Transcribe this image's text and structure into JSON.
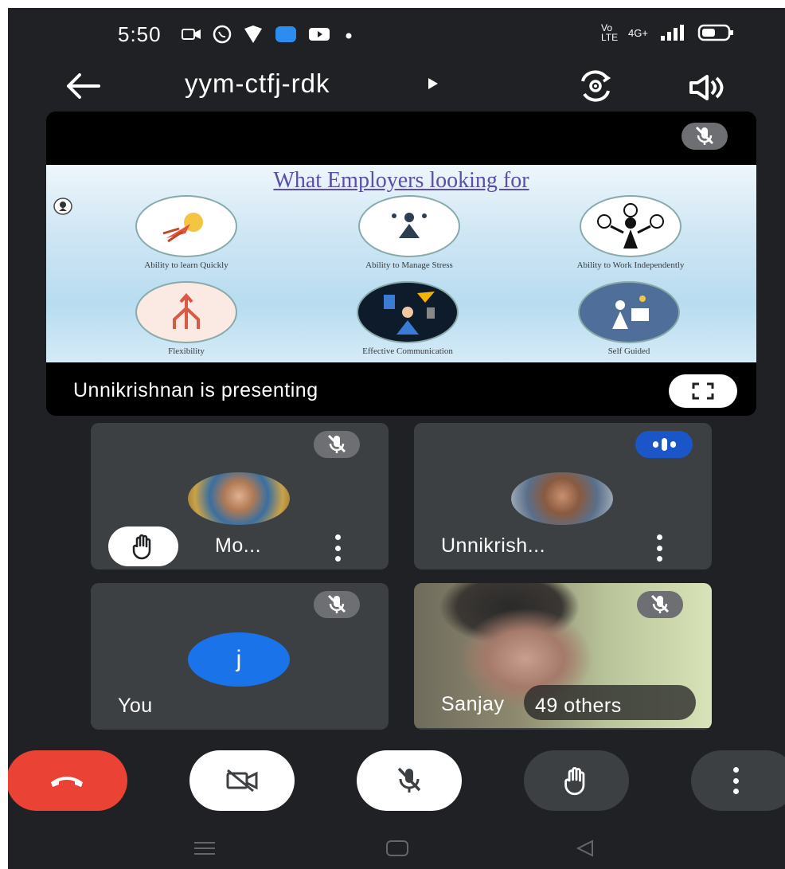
{
  "status_bar": {
    "time": "5:50",
    "network_label": "Vo LTE",
    "signal_label": "4G+"
  },
  "top_bar": {
    "meeting_code": "yym-ctfj-rdk"
  },
  "presentation": {
    "presenting_label": "Unnikrishnan is presenting",
    "slide": {
      "title": "What Employers looking for",
      "items": [
        {
          "label": "Ability to learn Quickly"
        },
        {
          "label": "Ability to Manage Stress"
        },
        {
          "label": "Ability to Work Independently"
        },
        {
          "label": "Flexibility"
        },
        {
          "label": "Effective Communication"
        },
        {
          "label": "Self Guided"
        }
      ]
    }
  },
  "participants": [
    {
      "name": "Mo...",
      "muted": true,
      "hand_raised": true
    },
    {
      "name": "Unnikrish...",
      "muted": false,
      "speaking": true
    },
    {
      "name": "You",
      "avatar_letter": "j",
      "muted": true
    },
    {
      "name": "Sanjay",
      "muted": true,
      "others_label": "49 others"
    }
  ],
  "colors": {
    "background": "#202124",
    "tile": "#3c4043",
    "end_call": "#ea4335",
    "avatar": "#1a73e8",
    "speaking": "#1a56c8"
  },
  "icons": {
    "back": "arrow-left-icon",
    "switch_camera": "switch-camera-icon",
    "speaker": "speaker-icon",
    "mic_off": "mic-off-icon",
    "fullscreen": "fullscreen-icon",
    "hand": "raise-hand-icon",
    "more": "more-vert-icon",
    "end_call": "phone-hangup-icon",
    "camera_off": "videocam-off-icon"
  }
}
